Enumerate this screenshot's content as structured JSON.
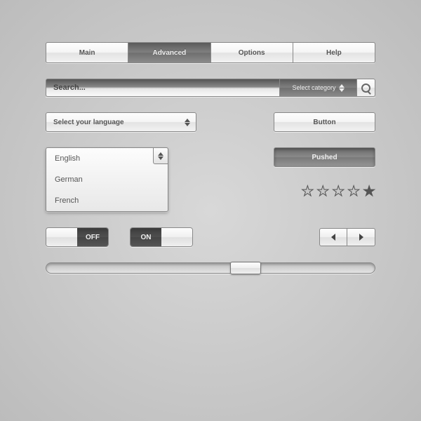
{
  "tabs": {
    "items": [
      "Main",
      "Advanced",
      "Options",
      "Help"
    ],
    "active": 1
  },
  "search": {
    "placeholder": "Search...",
    "category": "Select category"
  },
  "language": {
    "label": "Select your language",
    "options": [
      "English",
      "German",
      "French"
    ]
  },
  "buttons": {
    "normal": "Button",
    "pushed": "Pushed"
  },
  "rating": {
    "max": 5,
    "value": 1
  },
  "toggles": {
    "off": "OFF",
    "on": "ON"
  },
  "slider": {
    "value": 56
  }
}
